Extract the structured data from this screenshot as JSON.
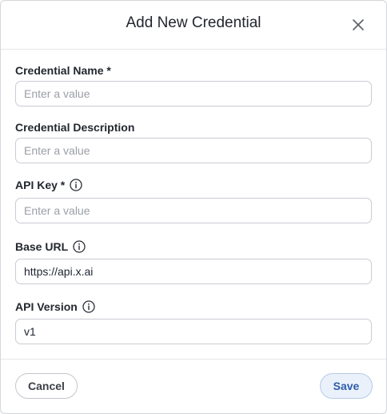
{
  "dialog": {
    "title": "Add New Credential"
  },
  "fields": {
    "name": {
      "label": "Credential Name *",
      "placeholder": "Enter a value",
      "value": ""
    },
    "description": {
      "label": "Credential Description",
      "placeholder": "Enter a value",
      "value": ""
    },
    "api_key": {
      "label": "API Key *",
      "placeholder": "Enter a value",
      "value": ""
    },
    "base_url": {
      "label": "Base URL",
      "placeholder": "",
      "value": "https://api.x.ai"
    },
    "api_version": {
      "label": "API Version",
      "placeholder": "",
      "value": "v1"
    }
  },
  "footer": {
    "cancel_label": "Cancel",
    "save_label": "Save"
  },
  "colors": {
    "save_bg": "#eaf1fb",
    "save_text": "#2e5da8",
    "border": "#c9ccd2"
  },
  "icons": {
    "close": "close-icon",
    "info": "info-icon"
  }
}
